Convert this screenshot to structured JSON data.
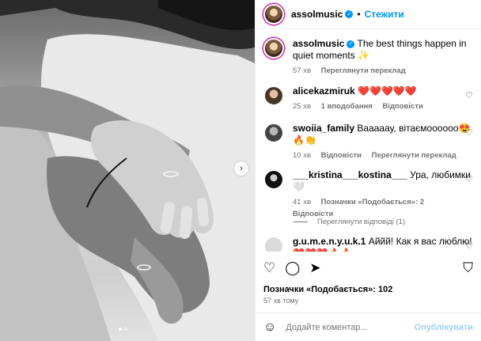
{
  "post": {
    "author": "assolmusic",
    "follow_label": "Стежити",
    "caption": "The best things happen in quiet moments ✨",
    "caption_time": "57 хв",
    "caption_translate": "Переглянути переклад"
  },
  "comments": [
    {
      "user": "alicekazmiruk",
      "text": "❤️❤️❤️❤️❤️",
      "time": "25 хв",
      "likes": "1 вподобання",
      "reply": "Відповісти"
    },
    {
      "user": "swoiia_family",
      "text": "Вааааау, вітаємоооооо😍🔥👏",
      "time": "10 хв",
      "reply": "Відповісти",
      "translate": "Переглянути переклад"
    },
    {
      "user": "___kristina___kostina___",
      "text": "Ура, любимки 🤍",
      "time": "41 хв",
      "likes": "Позначки «Подобається»: 2",
      "reply": "Відповісти",
      "view_replies": "Переглянути відповіді (1)"
    },
    {
      "user": "g.u.m.e.n.y.u.k.1",
      "text": "Аййй! Как я вас люблю!❤️❤️❤️🔥🔥"
    }
  ],
  "footer": {
    "likes": "Позначки «Подобається»: 102",
    "time": "57 хв тому",
    "comment_placeholder": "Додайте коментар...",
    "post_label": "Опублікувати"
  },
  "icons": {
    "like": "heart-icon",
    "comment": "comment-icon",
    "share": "share-icon",
    "save": "bookmark-icon",
    "emoji": "emoji-icon",
    "next": "chevron-right-icon"
  },
  "colors": {
    "accent": "#0095f6",
    "muted": "#737373",
    "post_disabled": "#9fd2fb"
  }
}
